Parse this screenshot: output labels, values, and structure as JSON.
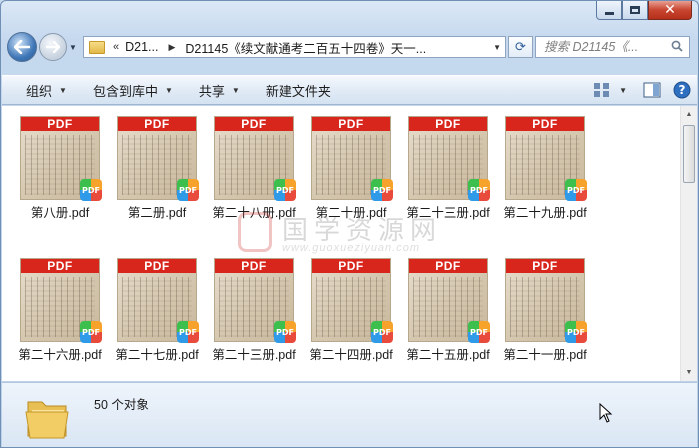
{
  "window": {
    "caption": {
      "minimize": "minimize",
      "maximize": "maximize",
      "close": "close"
    }
  },
  "address": {
    "chevrons": "«",
    "root": "D21...",
    "current": "D21145《续文献通考二百五十四卷》天一...",
    "refresh_symbol": "⟳"
  },
  "search": {
    "placeholder": "搜索 D21145《..."
  },
  "toolbar": {
    "organize": "组织",
    "include_in_library": "包含到库中",
    "share": "共享",
    "new_folder": "新建文件夹"
  },
  "files": [
    {
      "name": "第八册.pdf"
    },
    {
      "name": "第二册.pdf"
    },
    {
      "name": "第二十八册.pdf"
    },
    {
      "name": "第二十册.pdf"
    },
    {
      "name": "第二十三册.pdf"
    },
    {
      "name": "第二十九册.pdf"
    },
    {
      "name": "第二十六册.pdf"
    },
    {
      "name": "第二十七册.pdf"
    },
    {
      "name": "第二十三册.pdf"
    },
    {
      "name": "第二十四册.pdf"
    },
    {
      "name": "第二十五册.pdf"
    },
    {
      "name": "第二十一册.pdf"
    }
  ],
  "thumbnail": {
    "band_text": "PDF",
    "band_color": "#d9261c"
  },
  "watermark": {
    "text": "国学资源网",
    "url": "www.guoxueziyuan.com"
  },
  "status": {
    "count": "50 个对象"
  },
  "colors": {
    "window_frame": "#c5d8ee",
    "pdf_red": "#d9261c"
  }
}
